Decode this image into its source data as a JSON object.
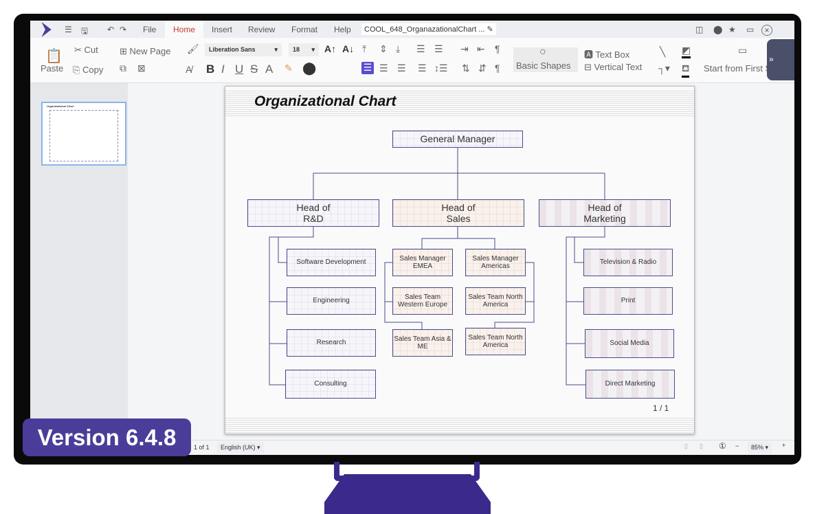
{
  "tabs": {
    "file": "File",
    "home": "Home",
    "insert": "Insert",
    "review": "Review",
    "format": "Format",
    "help": "Help"
  },
  "document_title": "COOL_648_OrganazationalChart ...",
  "ribbon": {
    "paste": "Paste",
    "cut": "Cut",
    "copy": "Copy",
    "new_page": "New Page",
    "font_name": "Liberation Sans",
    "font_size": "18",
    "basic_shapes": "Basic Shapes",
    "text_box": "Text Box",
    "vertical_text": "Vertical Text",
    "start_from_first": "Start from First S"
  },
  "slide": {
    "title": "Organizational Chart",
    "page_number": "1 / 1",
    "general_manager": "General Manager",
    "heads": [
      "Head of R&D",
      "Head of Sales",
      "Head of Marketing"
    ],
    "rnd": [
      "Software Development",
      "Engineering",
      "Research",
      "Consulting"
    ],
    "sales": [
      "Sales Manager EMEA",
      "Sales Manager Americas",
      "Sales Team Western Europe",
      "Sales Team North America",
      "Sales Team Asia & ME",
      "Sales Team North America"
    ],
    "marketing": [
      "Television & Radio",
      "Print",
      "Social Media",
      "Direct Marketing"
    ]
  },
  "status": {
    "slide_count": "1 of 1",
    "language": "English (UK)",
    "zoom": "85%"
  },
  "badge": "Version 6.4.8",
  "colors": {
    "accent": "#4a3d9a",
    "active_tab": "#c0392b"
  }
}
